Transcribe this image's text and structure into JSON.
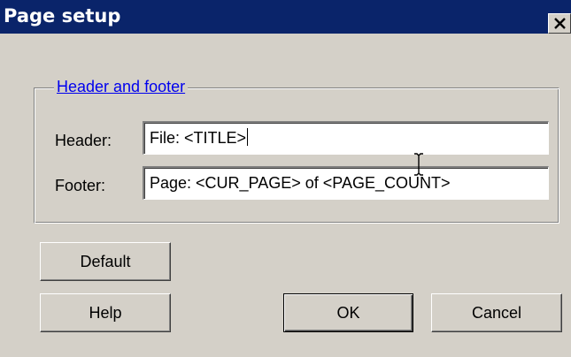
{
  "window": {
    "title": "Page setup",
    "close_icon": "close-icon"
  },
  "group": {
    "legend": "Header and footer"
  },
  "fields": {
    "header_label": "Header:",
    "header_value": "File: <TITLE>",
    "footer_label": "Footer:",
    "footer_value": "Page: <CUR_PAGE> of <PAGE_COUNT>"
  },
  "buttons": {
    "default_label": "Default",
    "help_label": "Help",
    "ok_label": "OK",
    "cancel_label": "Cancel"
  },
  "colors": {
    "titlebar": "#0a246a",
    "dialog_bg": "#d4d0c8",
    "link": "#0000ee"
  },
  "cursor": "text-cursor-icon"
}
